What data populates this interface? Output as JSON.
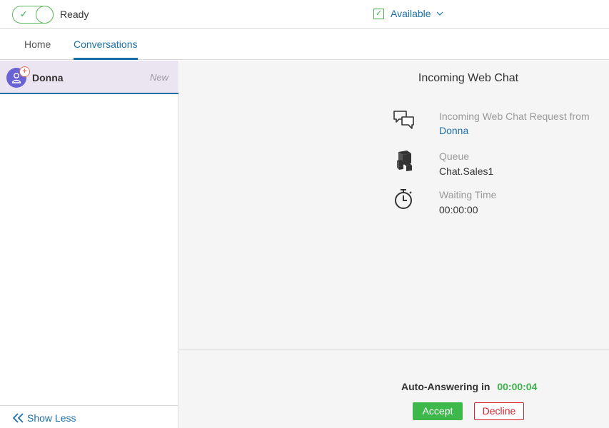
{
  "topbar": {
    "status_label": "Ready",
    "availability_label": "Available",
    "accent_green": "#3cb34a",
    "link_blue": "#1b6fa8"
  },
  "nav": {
    "tabs": [
      {
        "label": "Home",
        "active": false
      },
      {
        "label": "Conversations",
        "active": true
      }
    ]
  },
  "conversations": {
    "items": [
      {
        "name": "Donna",
        "status": "New",
        "avatar_icon": "user-icon",
        "badge_icon": "plus-icon"
      }
    ],
    "show_less_label": "Show Less"
  },
  "chat": {
    "title": "Incoming Web Chat",
    "request": {
      "label": "Incoming Web Chat Request from",
      "value": "Donna",
      "icon": "chat-bubbles-icon"
    },
    "queue": {
      "label": "Queue",
      "value": "Chat.Sales1",
      "icon": "queue-boxes-icon"
    },
    "waiting": {
      "label": "Waiting Time",
      "value": "00:00:00",
      "icon": "stopwatch-icon"
    },
    "auto_answer_label": "Auto-Answering in",
    "auto_answer_timer": "00:00:04",
    "accept_label": "Accept",
    "decline_label": "Decline"
  }
}
